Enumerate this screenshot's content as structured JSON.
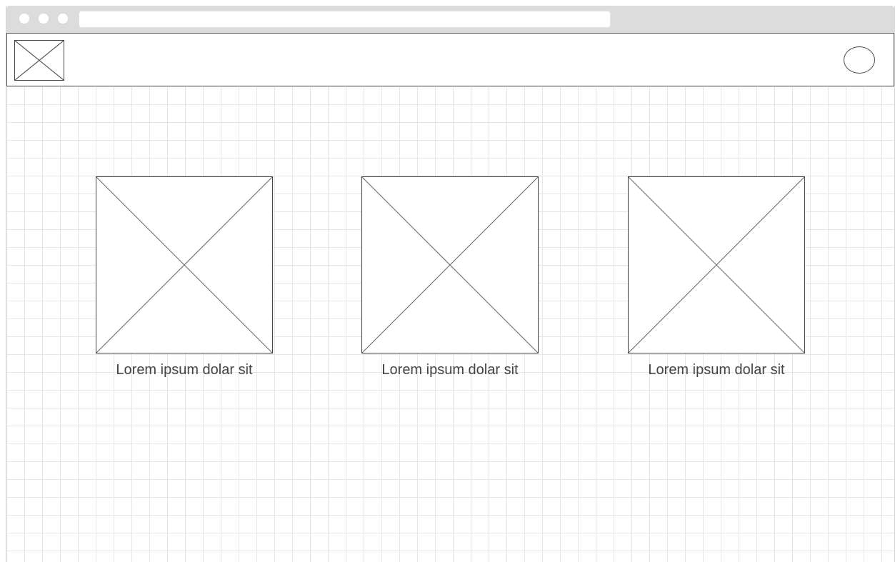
{
  "browser": {
    "window_controls": [
      "close",
      "minimize",
      "maximize"
    ],
    "address_bar": ""
  },
  "header": {
    "logo_icon": "image-placeholder-icon",
    "avatar_icon": "user-avatar-icon"
  },
  "gallery": {
    "cards": [
      {
        "icon": "image-placeholder-icon",
        "caption": "Lorem ipsum dolar sit"
      },
      {
        "icon": "image-placeholder-icon",
        "caption": "Lorem ipsum dolar sit"
      },
      {
        "icon": "image-placeholder-icon",
        "caption": "Lorem ipsum dolar sit"
      }
    ]
  },
  "colors": {
    "titlebar": "#dcdcdc",
    "outline": "#444444",
    "grid": "#e6e6e6",
    "text": "#444444"
  }
}
